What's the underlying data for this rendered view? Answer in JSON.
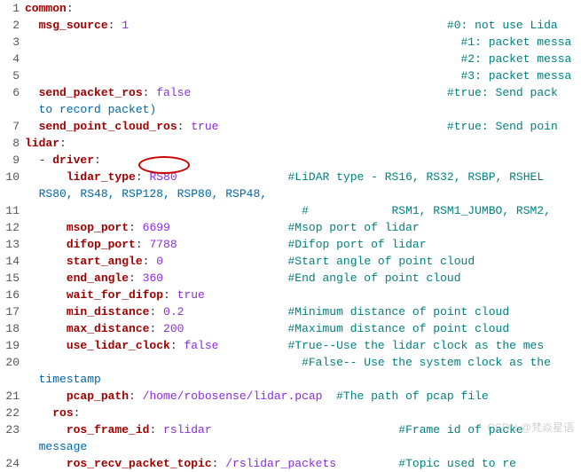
{
  "watermark": "CSDN @梵焱星语",
  "gutter": [
    "1",
    "2",
    "3",
    "4",
    "5",
    "6",
    "",
    "7",
    "8",
    "9",
    "10",
    "",
    "11",
    "12",
    "13",
    "14",
    "15",
    "16",
    "17",
    "18",
    "19",
    "20",
    "",
    "21",
    "22",
    "23",
    "",
    "24"
  ],
  "lines": [
    {
      "type": "kv",
      "indent": "",
      "key": "common",
      "colon": ":",
      "val": "",
      "cm": ""
    },
    {
      "type": "kv",
      "indent": "  ",
      "key": "msg_source",
      "colon": ": ",
      "val": "1",
      "sp": "                                              ",
      "cm": "#0: not use Lida"
    },
    {
      "type": "cm",
      "indent": "                                                               ",
      "cm": "#1: packet messa"
    },
    {
      "type": "cm",
      "indent": "                                                               ",
      "cm": "#2: packet messa"
    },
    {
      "type": "cm",
      "indent": "                                                               ",
      "cm": "#3: packet messa"
    },
    {
      "type": "kv",
      "indent": "  ",
      "key": "send_packet_ros",
      "colon": ": ",
      "val": "false",
      "sp": "                                     ",
      "cm": "#true: Send pack"
    },
    {
      "type": "wrap",
      "text": "  to record packet)"
    },
    {
      "type": "kv",
      "indent": "  ",
      "key": "send_point_cloud_ros",
      "colon": ": ",
      "val": "true",
      "sp": "                                 ",
      "cm": "#true: Send poin"
    },
    {
      "type": "kv",
      "indent": "",
      "key": "lidar",
      "colon": ":",
      "val": "",
      "cm": ""
    },
    {
      "type": "kv",
      "indent": "  - ",
      "key": "driver",
      "colon": ":",
      "val": "",
      "cm": ""
    },
    {
      "type": "kv",
      "indent": "      ",
      "key": "lidar_type",
      "colon": ": ",
      "val": "RS80",
      "sp": "                ",
      "cm": "#LiDAR type - RS16, RS32, RSBP, RSHEL"
    },
    {
      "type": "wrap",
      "text": "  RS80, RS48, RSP128, RSP80, RSP48,"
    },
    {
      "type": "cm",
      "indent": "                                        ",
      "cm": "#            RSM1, RSM1_JUMBO, RSM2,"
    },
    {
      "type": "kv",
      "indent": "      ",
      "key": "msop_port",
      "colon": ": ",
      "val": "6699",
      "sp": "                 ",
      "cm": "#Msop port of lidar"
    },
    {
      "type": "kv",
      "indent": "      ",
      "key": "difop_port",
      "colon": ": ",
      "val": "7788",
      "sp": "                ",
      "cm": "#Difop port of lidar"
    },
    {
      "type": "kv",
      "indent": "      ",
      "key": "start_angle",
      "colon": ": ",
      "val": "0",
      "sp": "                  ",
      "cm": "#Start angle of point cloud"
    },
    {
      "type": "kv",
      "indent": "      ",
      "key": "end_angle",
      "colon": ": ",
      "val": "360",
      "sp": "                  ",
      "cm": "#End angle of point cloud"
    },
    {
      "type": "kv",
      "indent": "      ",
      "key": "wait_for_difop",
      "colon": ": ",
      "val": "true",
      "sp": "",
      "cm": ""
    },
    {
      "type": "kv",
      "indent": "      ",
      "key": "min_distance",
      "colon": ": ",
      "val": "0.2",
      "sp": "               ",
      "cm": "#Minimum distance of point cloud"
    },
    {
      "type": "kv",
      "indent": "      ",
      "key": "max_distance",
      "colon": ": ",
      "val": "200",
      "sp": "               ",
      "cm": "#Maximum distance of point cloud"
    },
    {
      "type": "kv",
      "indent": "      ",
      "key": "use_lidar_clock",
      "colon": ": ",
      "val": "false",
      "sp": "          ",
      "cm": "#True--Use the lidar clock as the mes"
    },
    {
      "type": "cm",
      "indent": "                                        ",
      "cm": "#False-- Use the system clock as the "
    },
    {
      "type": "wrap",
      "text": "  timestamp"
    },
    {
      "type": "kv",
      "indent": "      ",
      "key": "pcap_path",
      "colon": ": ",
      "val": "/home/robosense/lidar.pcap",
      "sp": "  ",
      "cm": "#The path of pcap file"
    },
    {
      "type": "kv",
      "indent": "    ",
      "key": "ros",
      "colon": ":",
      "val": "",
      "cm": ""
    },
    {
      "type": "kv",
      "indent": "      ",
      "key": "ros_frame_id",
      "colon": ": ",
      "val": "rslidar",
      "sp": "                           ",
      "cm": "#Frame id of packe"
    },
    {
      "type": "wrap",
      "text": "  message"
    },
    {
      "type": "kv",
      "indent": "      ",
      "key": "ros_recv_packet_topic",
      "colon": ": ",
      "val": "/rslidar_packets",
      "sp": "         ",
      "cm": "#Topic used to re"
    }
  ]
}
